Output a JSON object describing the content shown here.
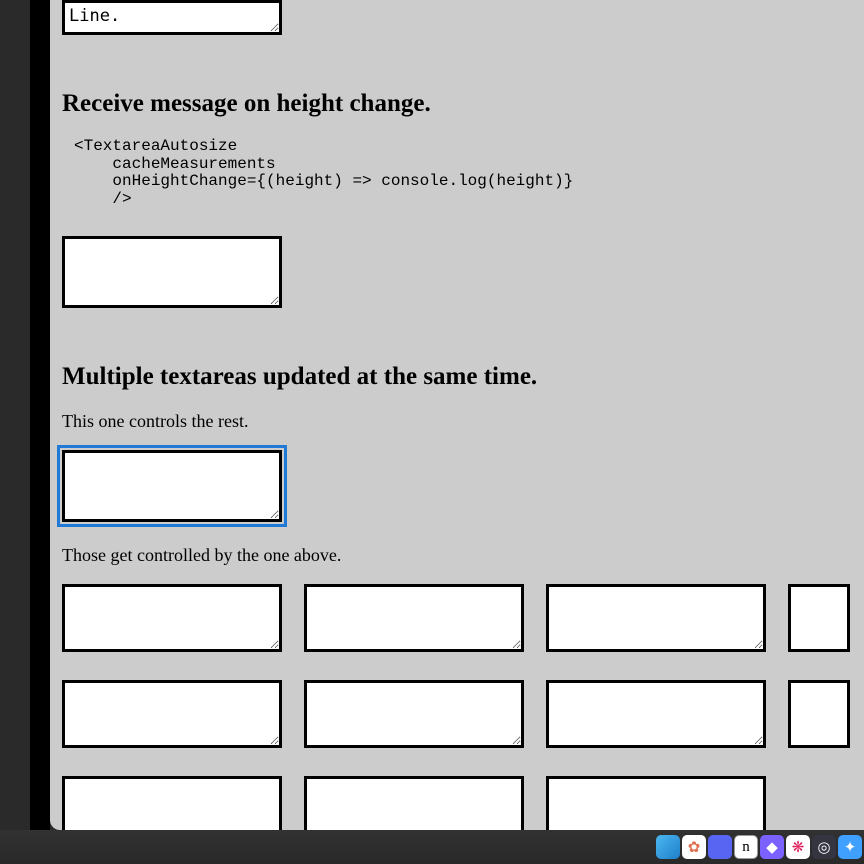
{
  "partial_textarea_value": "Line.",
  "heading_onheight": "Receive message on height change.",
  "code_onheight": "<TextareaAutosize\n    cacheMeasurements\n    onHeightChange={(height) => console.log(height)}\n    />",
  "heading_multi": "Multiple textareas updated at the same time.",
  "desc_controls": "This one controls the rest.",
  "desc_controlled": "Those get controlled by the one above.",
  "controller_value": "",
  "grid_count": 11,
  "dock": {
    "items": [
      {
        "name": "finder-icon",
        "glyph": ""
      },
      {
        "name": "photos-icon",
        "glyph": "✿"
      },
      {
        "name": "discord-icon",
        "glyph": ""
      },
      {
        "name": "notes-icon",
        "glyph": "n"
      },
      {
        "name": "app-purple-icon",
        "glyph": "◆"
      },
      {
        "name": "slack-icon",
        "glyph": "❋"
      },
      {
        "name": "chatgpt-icon",
        "glyph": "◎"
      },
      {
        "name": "app-blue-icon",
        "glyph": "✦"
      }
    ]
  }
}
